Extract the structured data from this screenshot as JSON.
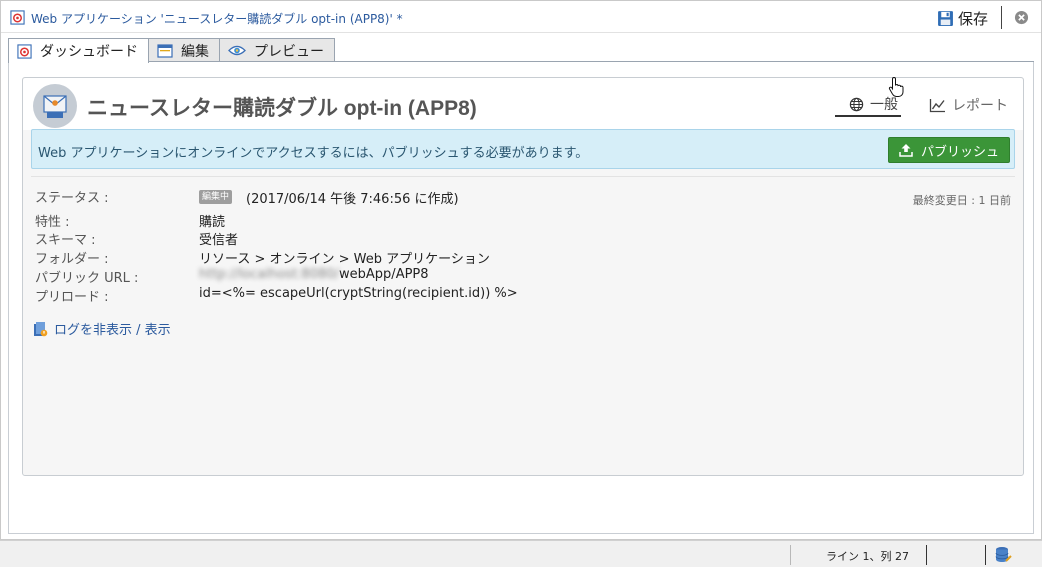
{
  "window": {
    "title": "Web アプリケーション 'ニュースレター購読ダブル opt-in (APP8)' *",
    "save_label": "保存"
  },
  "tabs": [
    {
      "label": "ダッシュボード",
      "icon": "app-icon",
      "active": true
    },
    {
      "label": "編集",
      "icon": "edit-window-icon",
      "active": false
    },
    {
      "label": "プレビュー",
      "icon": "eye-icon",
      "active": false
    }
  ],
  "card": {
    "title": "ニュースレター購読ダブル opt-in (APP8)",
    "view_tabs": [
      {
        "label": "一般",
        "icon": "globe-icon",
        "active": true
      },
      {
        "label": "レポート",
        "icon": "chart-line-icon",
        "active": false
      }
    ],
    "notice": "Web アプリケーションにオンラインでアクセスするには、パブリッシュする必要があります。",
    "publish_label": "パブリッシュ"
  },
  "info": {
    "status_label": "ステータス :",
    "status_badge": "編集中",
    "created": "(2017/06/14 午後 7:46:56 に作成)",
    "last_modified": "最終変更日 : 1 日前",
    "rows": [
      {
        "label": "特性 :",
        "value": "購読"
      },
      {
        "label": "スキーマ :",
        "value": "受信者"
      },
      {
        "label": "フォルダー :",
        "value": "リソース > オンライン > Web アプリケーション"
      },
      {
        "label": "パブリック URL :",
        "value_blurred": "http://localhost:8080/",
        "value": "webApp/APP8"
      },
      {
        "label": "プリロード :",
        "value": "id=<%= escapeUrl(cryptString(recipient.id)) %>"
      }
    ]
  },
  "log_link": "ログを非表示 / 表示",
  "statusbar": {
    "position": "ライン 1、列 27"
  },
  "colors": {
    "accent": "#2b5a9e",
    "publish": "#3b9538",
    "notice_bg": "#d6eef8"
  }
}
